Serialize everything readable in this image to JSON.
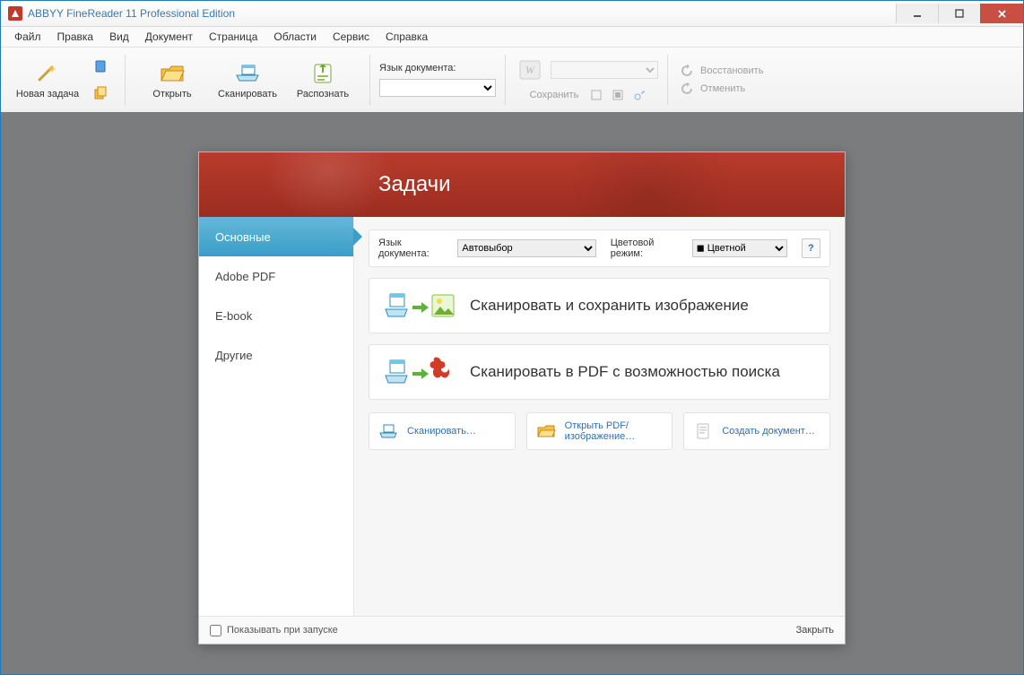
{
  "titlebar": {
    "title": "ABBYY FineReader 11 Professional Edition"
  },
  "menu": {
    "items": [
      "Файл",
      "Правка",
      "Вид",
      "Документ",
      "Страница",
      "Области",
      "Сервис",
      "Справка"
    ]
  },
  "toolbar": {
    "new_task": "Новая задача",
    "open": "Открыть",
    "scan": "Сканировать",
    "recognize": "Распознать",
    "lang_label": "Язык документа:",
    "lang_value": "",
    "save": "Сохранить",
    "restore": "Восстановить",
    "undo": "Отменить"
  },
  "tasks": {
    "title": "Задачи",
    "nav": [
      "Основные",
      "Adobe PDF",
      "E-book",
      "Другие"
    ],
    "active_nav_index": 0,
    "opt_lang_label": "Язык документа:",
    "opt_lang_value": "Автовыбор",
    "opt_color_label": "Цветовой режим:",
    "opt_color_value": "Цветной",
    "card1": "Сканировать и сохранить изображение",
    "card2": "Сканировать в PDF с возможностью поиска",
    "bottom": {
      "scan": "Сканировать…",
      "open_pdf": "Открыть PDF/изображение…",
      "create_doc": "Создать документ…"
    },
    "show_on_start": "Показывать при запуске",
    "close": "Закрыть",
    "help": "?"
  }
}
